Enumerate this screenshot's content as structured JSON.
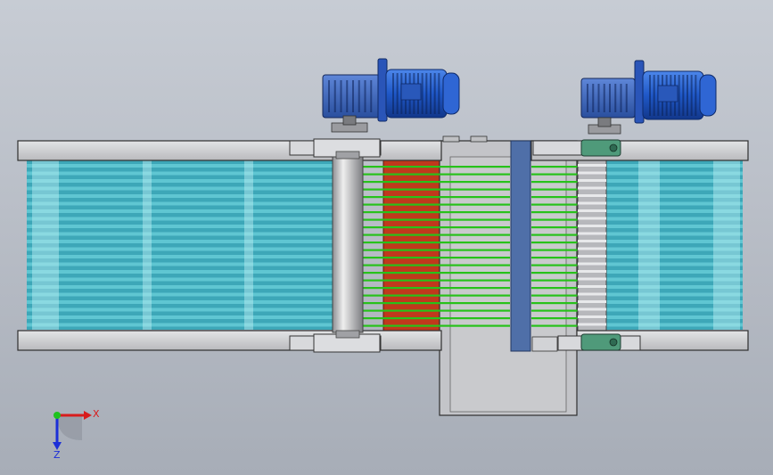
{
  "viewport": {
    "background_top": "#c7ccd4",
    "background_bottom": "#a7adb7"
  },
  "colors": {
    "frame": "#c9cacd",
    "frame_edge": "#3a3a3a",
    "belt_blue": "#5fc6d2",
    "belt_highlight": "#bfeff5",
    "belt_green": "#27c21a",
    "red_panel": "#c0391c",
    "motor_blue": "#1f58c8",
    "slot_blue": "#4f6fa8",
    "bearing_green": "#4f9a7a"
  },
  "motors": [
    {
      "id": "motor-left",
      "icon": "gear-motor-icon"
    },
    {
      "id": "motor-right",
      "icon": "gear-motor-icon"
    }
  ],
  "triad": {
    "x_label": "X",
    "z_label": "Z",
    "x_color": "#d81c1c",
    "y_color": "#1ec21e",
    "z_color": "#1c2fd8"
  }
}
